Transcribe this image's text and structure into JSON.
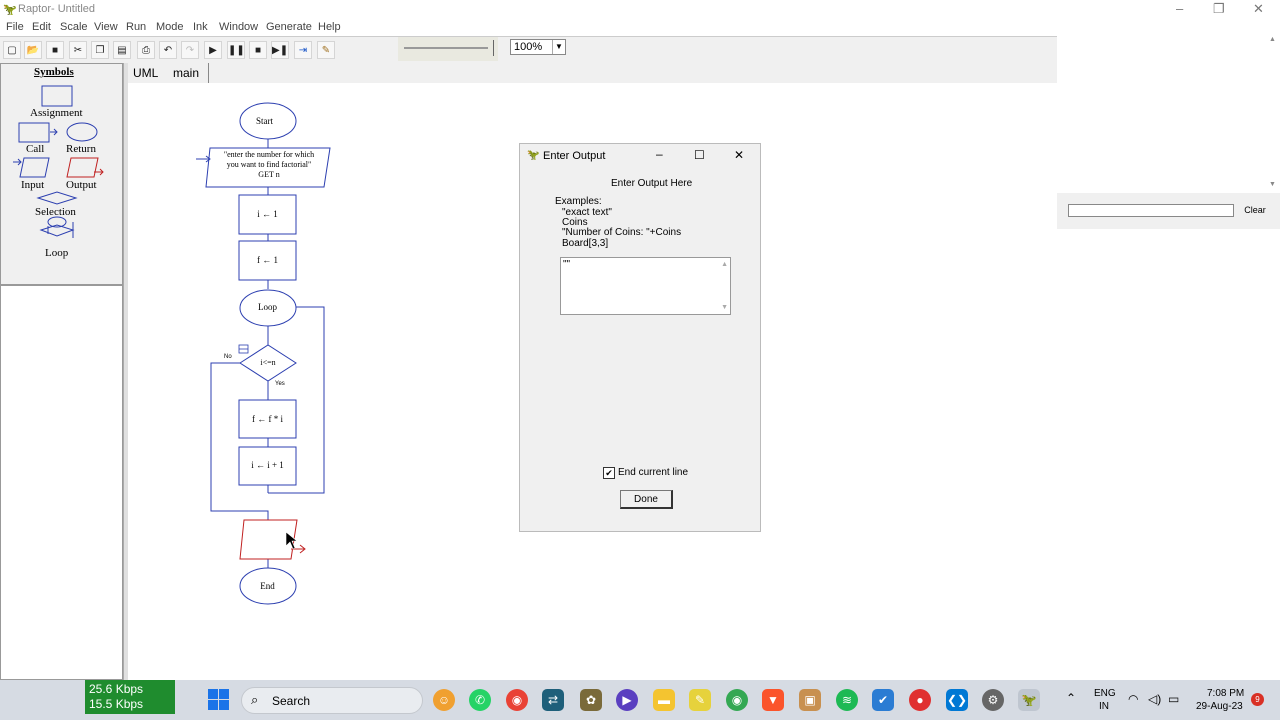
{
  "window": {
    "title": "Raptor- Untitled",
    "minimize": "–",
    "maximize": "❐",
    "close": "✕"
  },
  "menu": [
    "File",
    "Edit",
    "Scale",
    "View",
    "Run",
    "Mode",
    "Ink",
    "Window",
    "Generate",
    "Help"
  ],
  "toolbar": {
    "zoom_value": "100%"
  },
  "symbols": {
    "heading": "Symbols",
    "items": [
      "Assignment",
      "Call",
      "Return",
      "Input",
      "Output",
      "Selection",
      "Loop"
    ]
  },
  "tabs": [
    "UML",
    "main"
  ],
  "flowchart": {
    "start": "Start",
    "input_prompt": "\"enter the number for which",
    "input_prompt2": "you want to find factorial\"",
    "input_get": "GET n",
    "assign1": "i ← 1",
    "assign2": "f ← 1",
    "loop": "Loop",
    "condition": "i<=n",
    "no_label": "No",
    "yes_label": "Yes",
    "assign3": "f ← f * i",
    "assign4": "i ← i + 1",
    "end": "End"
  },
  "right_panel": {
    "clear_label": "Clear"
  },
  "dialog": {
    "title": "Enter Output",
    "heading": "Enter Output Here",
    "examples_label": "Examples:",
    "examples": [
      "\"exact text\"",
      "Coins",
      "\"Number of Coins: \"+Coins",
      "Board[3,3]"
    ],
    "text_value": "\"\"",
    "checkbox_label": "End current line",
    "checkbox_checked": true,
    "done_label": "Done"
  },
  "taskbar": {
    "upload_speed": "25.6 Kbps",
    "download_speed": "15.5 Kbps",
    "search_label": "Search",
    "language": "ENG",
    "region": "IN",
    "time": "7:08 PM",
    "date": "29-Aug-23",
    "notification_count": "9"
  }
}
